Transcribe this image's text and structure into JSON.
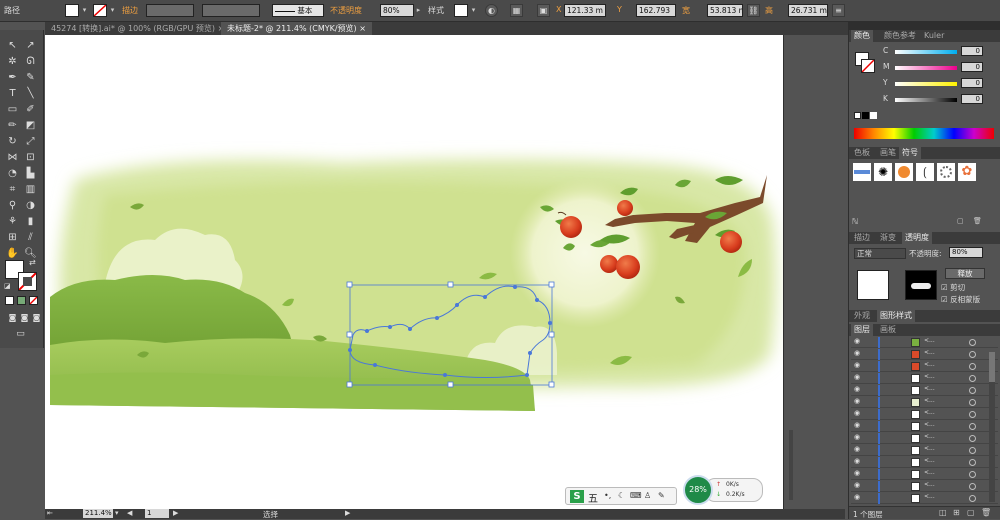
{
  "control_bar": {
    "object_type": "路径",
    "stroke_label": "描边",
    "stroke_style": "基本",
    "opacity_label": "不透明度",
    "opacity_value": "80%",
    "style_label": "样式",
    "x_label": "X",
    "x_value": "121.33 m",
    "y_label": "Y",
    "y_value": "162.793",
    "w_label": "宽",
    "w_value": "53.813 m",
    "h_label": "高",
    "h_value": "26.731 m"
  },
  "tabs": [
    {
      "label": "45274 [转换].ai* @ 100% (RGB/GPU 预览)",
      "close": "×"
    },
    {
      "label": "未标题-2* @ 211.4% (CMYK/预览)",
      "close": "×"
    }
  ],
  "status_bar": {
    "zoom": "211.4%",
    "page": "1",
    "tool": "选择"
  },
  "ime": {
    "logo": "S",
    "mode": "五",
    "percent": "28%",
    "up_speed": "0K/s",
    "down_speed": "0.2K/s"
  },
  "color_panel": {
    "tabs": [
      "颜色",
      "颜色参考",
      "Kuler"
    ],
    "channels": [
      {
        "label": "C",
        "value": "0",
        "color": "#00aeef"
      },
      {
        "label": "M",
        "value": "0",
        "color": "#ec008c"
      },
      {
        "label": "Y",
        "value": "0",
        "color": "#fff200"
      },
      {
        "label": "K",
        "value": "0",
        "color": "#000000"
      }
    ]
  },
  "swatch_panel": {
    "tabs": [
      "色板",
      "画笔",
      "符号"
    ]
  },
  "transparency_panel": {
    "tabs": [
      "描边",
      "渐变",
      "透明度"
    ],
    "blend_mode": "正常",
    "opacity_label": "不透明度:",
    "opacity_value": "80%",
    "release_button": "释放",
    "clip_label": "剪切",
    "invert_label": "反相蒙版"
  },
  "appearance_tabs": [
    "外观",
    "图形样式"
  ],
  "layers_panel": {
    "tabs": [
      "图层",
      "画板"
    ],
    "rows": [
      {
        "name": "<...",
        "thumb": "#7ab040"
      },
      {
        "name": "<...",
        "thumb": "#d94a2a"
      },
      {
        "name": "<...",
        "thumb": "#d94a2a"
      },
      {
        "name": "<...",
        "thumb": "#ffffff"
      },
      {
        "name": "<...",
        "thumb": "#ffffff"
      },
      {
        "name": "<...",
        "thumb": "#e8efd0"
      },
      {
        "name": "<...",
        "thumb": "#ffffff"
      },
      {
        "name": "<...",
        "thumb": "#ffffff"
      },
      {
        "name": "<...",
        "thumb": "#ffffff"
      },
      {
        "name": "<...",
        "thumb": "#ffffff"
      },
      {
        "name": "<...",
        "thumb": "#ffffff"
      },
      {
        "name": "<...",
        "thumb": "#ffffff"
      },
      {
        "name": "<...",
        "thumb": "#ffffff"
      },
      {
        "name": "<...",
        "thumb": "#ffffff"
      }
    ],
    "footer": "1 个图层"
  },
  "colors": {
    "accent": "#4a78d8",
    "selection": "#4a78d8"
  }
}
